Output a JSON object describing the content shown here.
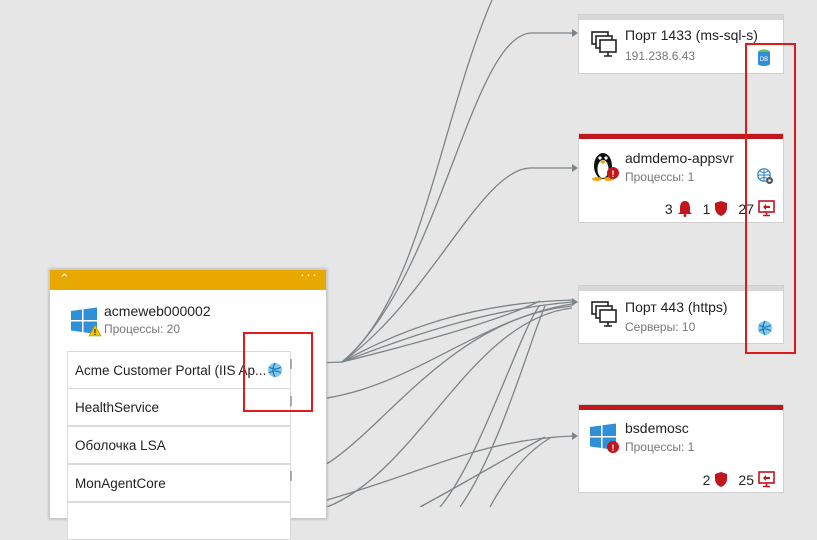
{
  "colors": {
    "alert_bar": "#c0161c",
    "neutral_bar": "#d8d8d8",
    "group_header": "#e8a800",
    "highlight": "#e01a1a",
    "connector": "#7d8487"
  },
  "group": {
    "machine_name": "acmeweb000002",
    "processes_label": "Процессы: 20",
    "processes": [
      {
        "label": "Acme Customer Portal (IIS Ap...",
        "icon": "iis-globe-icon"
      },
      {
        "label": "HealthService"
      },
      {
        "label": "Оболочка LSA"
      },
      {
        "label": "MonAgentCore"
      }
    ]
  },
  "nodes": {
    "port1433": {
      "title": "Порт 1433  (ms-sql-s)",
      "subtitle": "191.238.6.43",
      "icon": "monitors-icon",
      "badge_icon": "database-icon"
    },
    "appsvr": {
      "title": "admdemo-appsvr",
      "subtitle": "Процессы: 1",
      "icon": "linux-penguin-icon",
      "alerts_count": "3",
      "security_count": "1",
      "updates_count": "27",
      "badge_icon": "globe-gear-icon"
    },
    "port443": {
      "title": "Порт 443  (https)",
      "subtitle": "Серверы: 10",
      "icon": "monitors-icon",
      "badge_icon": "globe-icon"
    },
    "bsdemosc": {
      "title": "bsdemosc",
      "subtitle": "Процессы: 1",
      "icon": "windows-logo-icon",
      "security_count": "2",
      "updates_count": "25"
    }
  }
}
